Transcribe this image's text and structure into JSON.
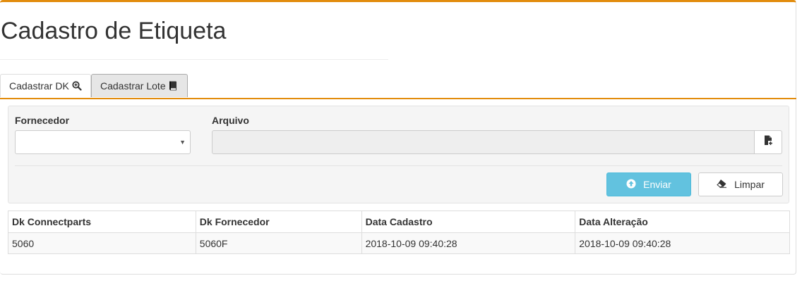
{
  "page": {
    "title": "Cadastro de Etiqueta"
  },
  "tabs": [
    {
      "label": "Cadastrar DK",
      "icon": "search-plus-icon",
      "active": true
    },
    {
      "label": "Cadastrar Lote",
      "icon": "book-icon",
      "active": false
    }
  ],
  "accent_color": "#e28c0d",
  "form": {
    "supplier_label": "Fornecedor",
    "supplier_value": "",
    "file_label": "Arquivo",
    "file_value": "",
    "send_label": "Enviar",
    "send_icon": "upload-circle-icon",
    "clear_label": "Limpar",
    "clear_icon": "eraser-icon"
  },
  "table": {
    "columns": [
      "Dk Connectparts",
      "Dk Fornecedor",
      "Data Cadastro",
      "Data Alteração"
    ],
    "rows": [
      [
        "5060",
        "5060F",
        "2018-10-09 09:40:28",
        "2018-10-09 09:40:28"
      ]
    ]
  }
}
